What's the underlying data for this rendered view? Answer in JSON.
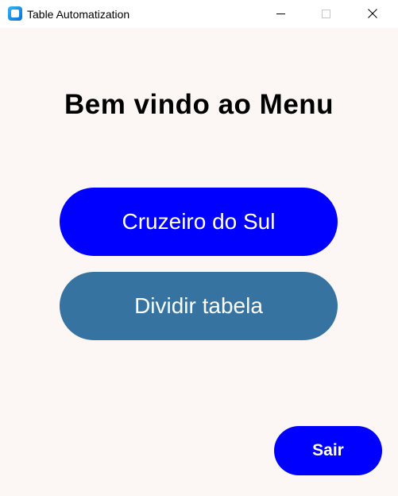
{
  "window": {
    "title": "Table Automatization",
    "icon": "app-icon",
    "controls": [
      "minimize-icon",
      "maximize-icon",
      "close-icon"
    ]
  },
  "main": {
    "heading": "Bem vindo ao Menu",
    "buttons": {
      "cruzeiro": "Cruzeiro do Sul",
      "dividir": "Dividir tabela",
      "sair": "Sair"
    }
  },
  "colors": {
    "background": "#fcf6f5",
    "primary_button": "#0000ff",
    "secondary_button": "#3673a0",
    "button_text": "#ffffff"
  }
}
